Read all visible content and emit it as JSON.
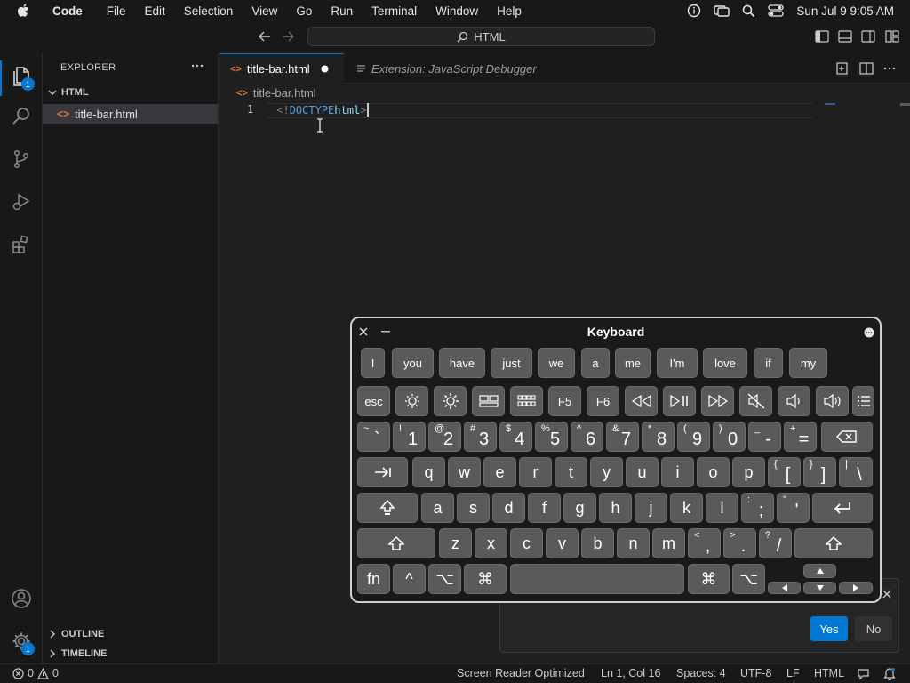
{
  "menubar": {
    "app": "Code",
    "items": [
      "File",
      "Edit",
      "Selection",
      "View",
      "Go",
      "Run",
      "Terminal",
      "Window",
      "Help"
    ],
    "clock": "Sun Jul 9  9:05 AM"
  },
  "titlebar": {
    "search": "HTML"
  },
  "activity": {
    "explorer_badge": "1",
    "settings_badge": "1"
  },
  "sidebar": {
    "title": "EXPLORER",
    "folder": "HTML",
    "file": "title-bar.html",
    "outline": "OUTLINE",
    "timeline": "TIMELINE"
  },
  "tabs": [
    {
      "label": "title-bar.html",
      "active": true,
      "dirty": true
    },
    {
      "label": "Extension: JavaScript Debugger",
      "active": false
    }
  ],
  "editor": {
    "breadcrumb": "title-bar.html",
    "line_number": "1",
    "code_punct_open": "<!",
    "code_keyword": "DOCTYPE",
    "code_attr": " html",
    "code_punct_close": ">"
  },
  "dialog": {
    "yes": "Yes",
    "no": "No"
  },
  "keyboard": {
    "title": "Keyboard",
    "suggestions": [
      "I",
      "you",
      "have",
      "just",
      "we",
      "a",
      "me",
      "I'm",
      "love",
      "if",
      "my"
    ],
    "fkeys": {
      "esc": "esc",
      "f5": "F5",
      "f6": "F6"
    },
    "number_row": [
      {
        "s": "~",
        "m": "`"
      },
      {
        "s": "!",
        "m": "1"
      },
      {
        "s": "@",
        "m": "2"
      },
      {
        "s": "#",
        "m": "3"
      },
      {
        "s": "$",
        "m": "4"
      },
      {
        "s": "%",
        "m": "5"
      },
      {
        "s": "^",
        "m": "6"
      },
      {
        "s": "&",
        "m": "7"
      },
      {
        "s": "*",
        "m": "8"
      },
      {
        "s": "(",
        "m": "9"
      },
      {
        "s": ")",
        "m": "0"
      },
      {
        "s": "_",
        "m": "-"
      },
      {
        "s": "+",
        "m": "="
      }
    ],
    "row_q": [
      "q",
      "w",
      "e",
      "r",
      "t",
      "y",
      "u",
      "i",
      "o",
      "p"
    ],
    "row_q_extra": [
      {
        "s": "{",
        "m": "["
      },
      {
        "s": "}",
        "m": "]"
      },
      {
        "s": "|",
        "m": "\\"
      }
    ],
    "row_a": [
      "a",
      "s",
      "d",
      "f",
      "g",
      "h",
      "j",
      "k",
      "l"
    ],
    "row_a_extra": [
      {
        "s": ":",
        "m": ";"
      },
      {
        "s": "\"",
        "m": "'"
      }
    ],
    "row_z": [
      "z",
      "x",
      "c",
      "v",
      "b",
      "n",
      "m"
    ],
    "row_z_extra": [
      {
        "s": "<",
        "m": ","
      },
      {
        "s": ">",
        "m": "."
      },
      {
        "s": "?",
        "m": "/"
      }
    ],
    "bottom": {
      "fn": "fn",
      "ctrl": "^",
      "opt": "⌥",
      "cmd": "⌘"
    }
  },
  "status": {
    "errors": "0",
    "warnings": "0",
    "screen_reader": "Screen Reader Optimized",
    "position": "Ln 1, Col 16",
    "spaces": "Spaces: 4",
    "encoding": "UTF-8",
    "eol": "LF",
    "language": "HTML"
  },
  "colors": {
    "accent": "#0078d4",
    "keyword": "#569cd6",
    "punct": "#808080"
  }
}
